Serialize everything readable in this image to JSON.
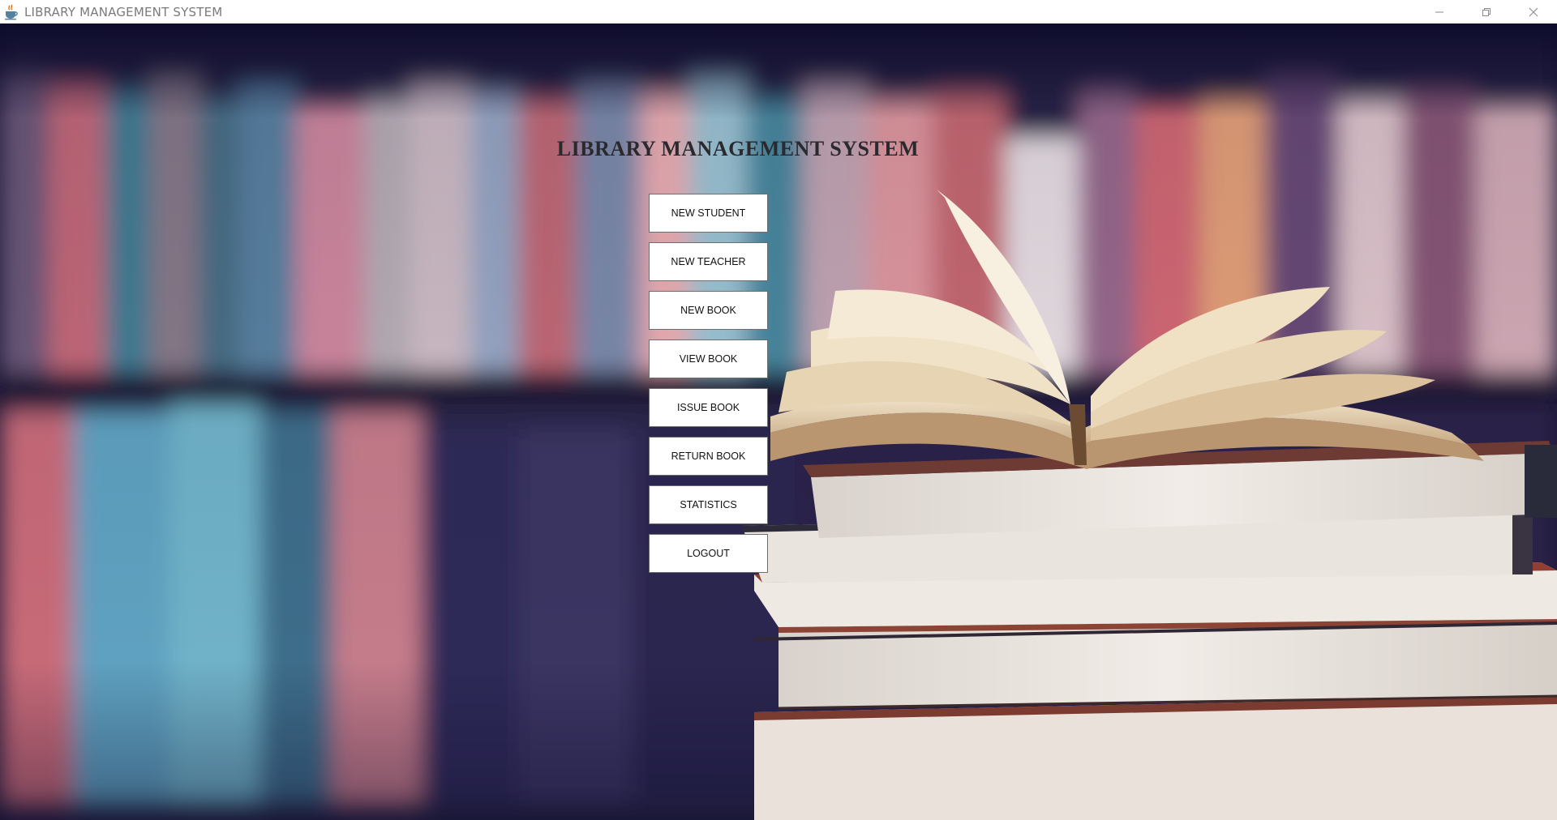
{
  "window": {
    "title": "LIBRARY MANAGEMENT SYSTEM",
    "app_icon": "java-coffee-cup-icon",
    "controls": [
      "minimize-icon",
      "restore-icon",
      "close-icon"
    ]
  },
  "main": {
    "heading": "LIBRARY MANAGEMENT SYSTEM",
    "buttons": [
      "NEW STUDENT",
      "NEW TEACHER",
      "NEW BOOK",
      "VIEW BOOK",
      "ISSUE BOOK",
      "RETURN BOOK",
      "STATISTICS",
      "LOGOUT"
    ]
  },
  "colors": {
    "background_dark": "#1b1838",
    "heading": "#2a2a2e",
    "button_bg": "#ffffff",
    "button_border": "#6d6d6d"
  }
}
